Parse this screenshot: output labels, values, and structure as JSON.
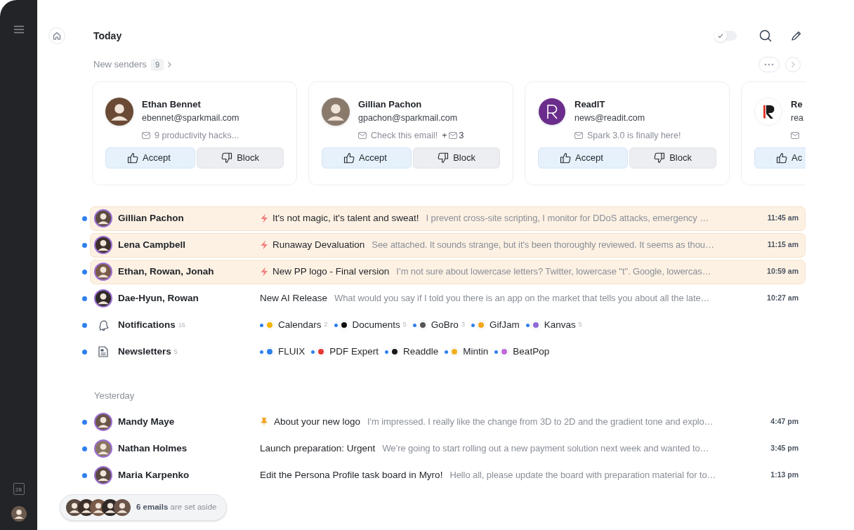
{
  "sidebar": {
    "calendar_day": "28"
  },
  "header": {
    "title": "Today",
    "done_toggle": {
      "on": false
    }
  },
  "new_senders": {
    "label": "New senders",
    "count": "9",
    "cards": [
      {
        "kind": "person",
        "name": "Ethan Bennet",
        "email": "ebennet@sparkmail.com",
        "preview": "9 productivity hacks...",
        "accept": "Accept",
        "block": "Block"
      },
      {
        "kind": "person",
        "name": "Gillian Pachon",
        "email": "gpachon@sparkmail.com",
        "preview": "Check this email!",
        "more_label": "+",
        "more_count": "3",
        "accept": "Accept",
        "block": "Block"
      },
      {
        "kind": "readit",
        "name": "ReadIT",
        "email": "news@readit.com",
        "preview": "Spark 3.0 is finally here!",
        "accept": "Accept",
        "block": "Block"
      },
      {
        "kind": "readdle",
        "name": "Re",
        "email": "rea",
        "accept": "Ac"
      }
    ]
  },
  "sections": [
    {
      "rows": [
        {
          "kind": "mail",
          "sender": "Gillian Pachon",
          "subject": "It's not magic, it's talent and sweat!",
          "preview": "I prevent cross-site scripting, I monitor for DDoS attacks, emergency …",
          "time": "11:45 am",
          "unread": true,
          "highlighted": true,
          "priority": true,
          "pinned": false
        },
        {
          "kind": "mail",
          "sender": "Lena Campbell",
          "subject": "Runaway Devaluation",
          "preview": "See attached. It sounds strange, but it's been thoroughly reviewed. It seems as thou…",
          "time": "11:15 am",
          "unread": true,
          "highlighted": true,
          "priority": true,
          "pinned": false
        },
        {
          "kind": "mail",
          "sender": "Ethan, Rowan, Jonah",
          "subject": "New PP logo - Final version",
          "preview": "I’m not sure about lowercase letters? Twitter, lowercase \"t\". Google, lowercas…",
          "time": "10:59 am",
          "unread": true,
          "highlighted": true,
          "priority": true,
          "pinned": false
        },
        {
          "kind": "mail",
          "sender": "Dae-Hyun, Rowan",
          "subject": "New AI Release",
          "preview": "What would you say if I told you there is an app on the market that tells you about all the late…",
          "time": "10:27 am",
          "unread": true,
          "highlighted": false,
          "priority": false,
          "pinned": false
        },
        {
          "kind": "notifications",
          "sender": "Notifications",
          "count": "16",
          "unread": true,
          "apps": [
            {
              "name": "Calendars",
              "count": "2",
              "color": "#f4b400"
            },
            {
              "name": "Documents",
              "count": "5",
              "color": "#111111"
            },
            {
              "name": "GoBro",
              "count": "3",
              "color": "#555555"
            },
            {
              "name": "GifJam",
              "color": "#f5a623"
            },
            {
              "name": "Kanvas",
              "count": "5",
              "color": "#8e6bd8"
            }
          ]
        },
        {
          "kind": "newsletters",
          "sender": "Newsletters",
          "count": "5",
          "unread": true,
          "apps": [
            {
              "name": "FLUIX",
              "color": "#2f80ed"
            },
            {
              "name": "PDF Expert",
              "color": "#e53935"
            },
            {
              "name": "Readdle",
              "color": "#1a1a1a"
            },
            {
              "name": "Mintin",
              "color": "#f2b01e"
            },
            {
              "name": "BeatPop",
              "color": "#c06bd8"
            }
          ]
        }
      ]
    },
    {
      "heading": "Yesterday",
      "rows": [
        {
          "kind": "mail",
          "sender": "Mandy Maye",
          "subject": "About your new logo",
          "preview": "I'm impressed. I really like the change from 3D to 2D and the gradient tone and explo…",
          "time": "4:47 pm",
          "unread": true,
          "highlighted": false,
          "priority": false,
          "pinned": true
        },
        {
          "kind": "mail",
          "sender": "Nathan Holmes",
          "subject": "Launch preparation: Urgent",
          "preview": "We’re going to start rolling out a new payment solution next week and wanted to…",
          "time": "3:45 pm",
          "unread": true,
          "highlighted": false,
          "priority": false,
          "pinned": false
        },
        {
          "kind": "mail",
          "sender": "Maria Karpenko",
          "subject": "Edit the Persona Profile task board in Myro!",
          "preview": "Hello all, please update the board with preparation material for to…",
          "time": "1:13 pm",
          "unread": true,
          "highlighted": false,
          "priority": false,
          "pinned": false
        }
      ]
    }
  ],
  "set_aside": {
    "text": "**6 emails** are set aside"
  }
}
